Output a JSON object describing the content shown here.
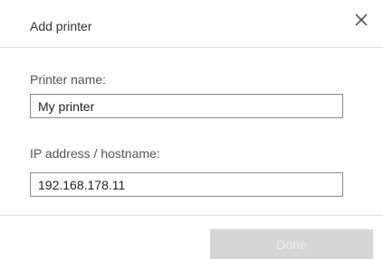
{
  "dialog": {
    "title": "Add printer",
    "close_icon": "close-icon"
  },
  "form": {
    "printer_name": {
      "label": "Printer name:",
      "value": "My printer"
    },
    "ip_address": {
      "label": "IP address / hostname:",
      "value": "192.168.178.11"
    }
  },
  "footer": {
    "done_label": "Done",
    "done_enabled": false
  },
  "colors": {
    "divider": "#dcdcdc",
    "button_disabled_bg": "#d6d6d6",
    "button_disabled_text": "#eeeeee",
    "field_border": "#8a8a8a"
  }
}
